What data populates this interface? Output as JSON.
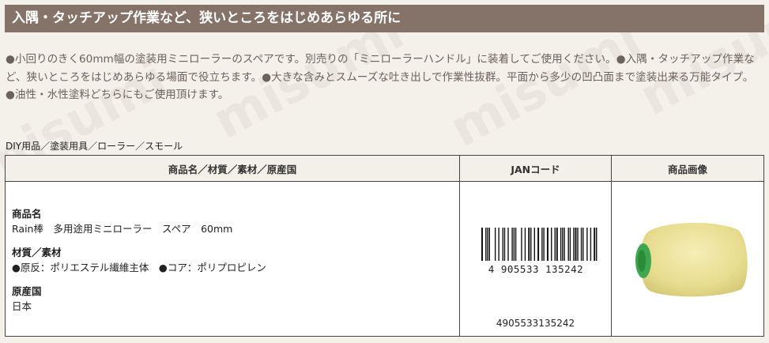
{
  "banner": {
    "title": "入隅・タッチアップ作業など、狭いところをはじめあらゆる所に"
  },
  "description": {
    "text": "●小回りのきく60mm幅の塗装用ミニローラーのスペアです。別売りの「ミニローラーハンドル」に装着してご使用ください。●入隅・タッチアップ作業など、狭いところをはじめあらゆる場面で役立ちます。●大きな含みとスムーズな吐き出しで作業性抜群。平面から多少の凹凸面まで塗装出来る万能タイプ。●油性・水性塗料どちらにもご使用頂けます。"
  },
  "breadcrumb": "DIY用品／塗装用具／ローラー／スモール",
  "watermark": "misumi",
  "table": {
    "headers": [
      "商品名／材質／素材／原産国",
      "JANコード",
      "商品画像"
    ],
    "product": {
      "name_label": "商品名",
      "name": "Rain棒　多用途用ミニローラー　スペア　60mm",
      "material_label": "材質／素材",
      "material": "●原反：ポリエステル繊維主体　●コア：ポリプロピレン",
      "origin_label": "原産国",
      "origin": "日本"
    },
    "jan": {
      "code": "4905533135242",
      "barcode_digits": "4 905533 135242"
    },
    "image": {
      "alt": "ミニローラー スペア",
      "roller_color": "#efe6a2",
      "core_color": "#3ea64e"
    }
  },
  "colors": {
    "banner_bg": "#857268",
    "page_bg": "#f4f0ea"
  }
}
